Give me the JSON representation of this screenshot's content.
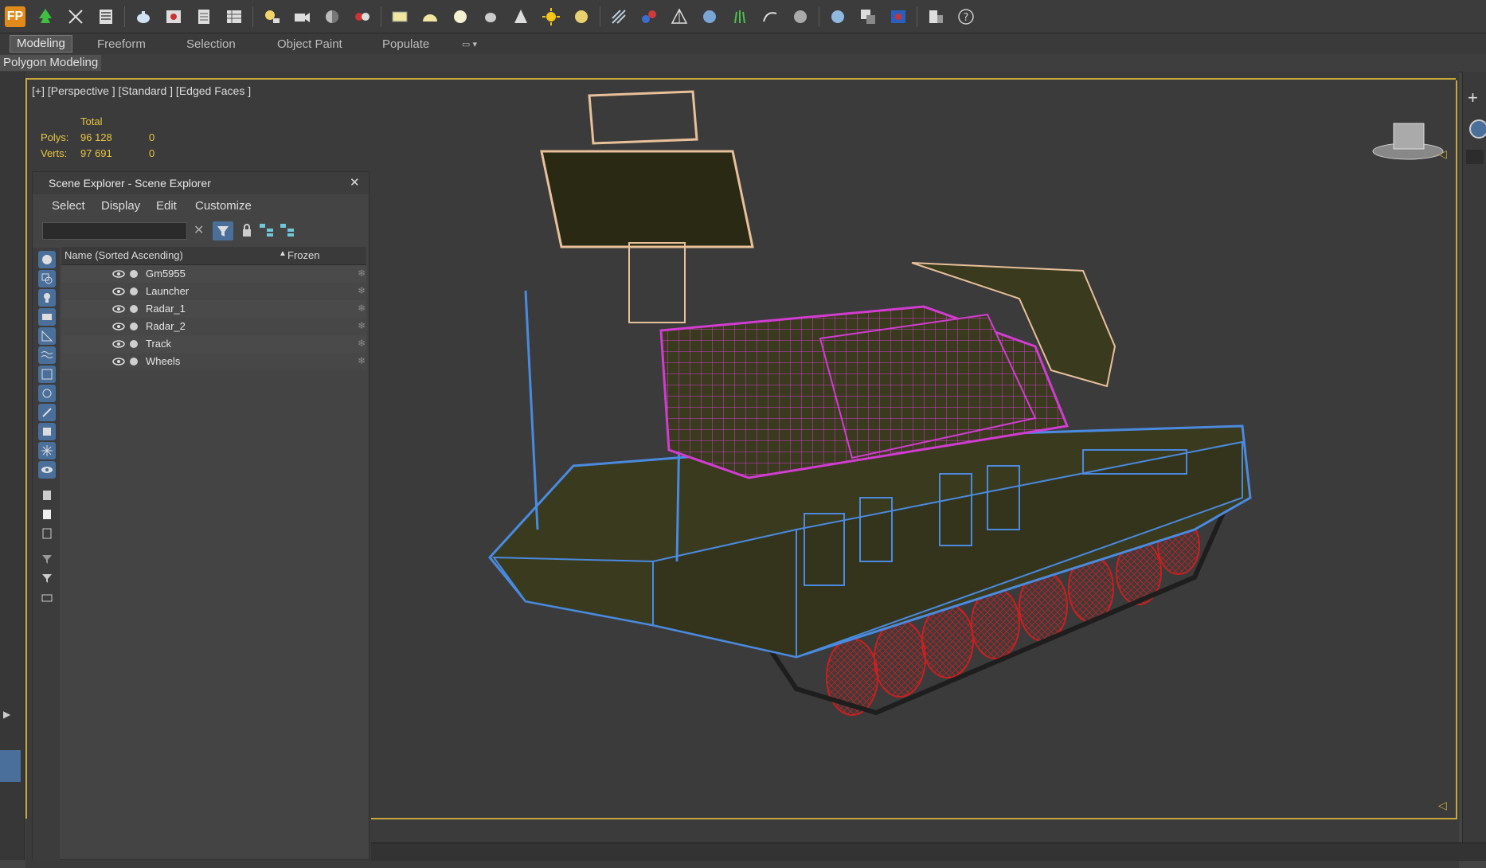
{
  "toolbar": {
    "logo_label": "FP",
    "icons": [
      "tree-icon",
      "scissors-icon",
      "list-icon",
      "teapot-icon",
      "render-frame-icon",
      "document-icon",
      "table-icon",
      "light-icon",
      "camera-icon",
      "material-ball-icon",
      "material-editor-icon",
      "plane-icon",
      "dome-icon",
      "sphere-icon",
      "teapot2-icon",
      "cone-icon",
      "sun-icon",
      "disc-icon",
      "grid-icon",
      "molecule-icon",
      "pyramid-icon",
      "gear-sphere-icon",
      "grass-icon",
      "hf-icon",
      "sphere-blue-icon",
      "render-setup-icon",
      "render-icon",
      "layers-icon",
      "help-icon"
    ]
  },
  "ribbon": {
    "tabs": [
      "Modeling",
      "Freeform",
      "Selection",
      "Object Paint",
      "Populate"
    ],
    "active_tab": "Modeling",
    "sub_label": "Polygon Modeling"
  },
  "viewport": {
    "label": "[+] [Perspective ] [Standard ] [Edged Faces ]",
    "stats": {
      "total_label": "Total",
      "polys_label": "Polys:",
      "polys_total": "96 128",
      "polys_sel": "0",
      "verts_label": "Verts:",
      "verts_total": "97 691",
      "verts_sel": "0"
    }
  },
  "scene_explorer": {
    "title": "Scene Explorer - Scene Explorer",
    "close_symbol": "✕",
    "menu": [
      "Select",
      "Display",
      "Edit",
      "Customize"
    ],
    "search_placeholder": "",
    "columns": {
      "name": "Name (Sorted Ascending)",
      "sort_symbol": "▲",
      "frozen": "Frozen"
    },
    "items": [
      "Gm5955",
      "Launcher",
      "Radar_1",
      "Radar_2",
      "Track",
      "Wheels"
    ],
    "frozen_symbol": "❄"
  },
  "colors": {
    "frame": "#c8a83c",
    "hull_wire": "#4a8ae0",
    "turret_wire": "#d23cd2",
    "radar_wire": "#e8c09a",
    "wheels_wire": "#c82020",
    "hull_fill": "#3a3a1e"
  }
}
